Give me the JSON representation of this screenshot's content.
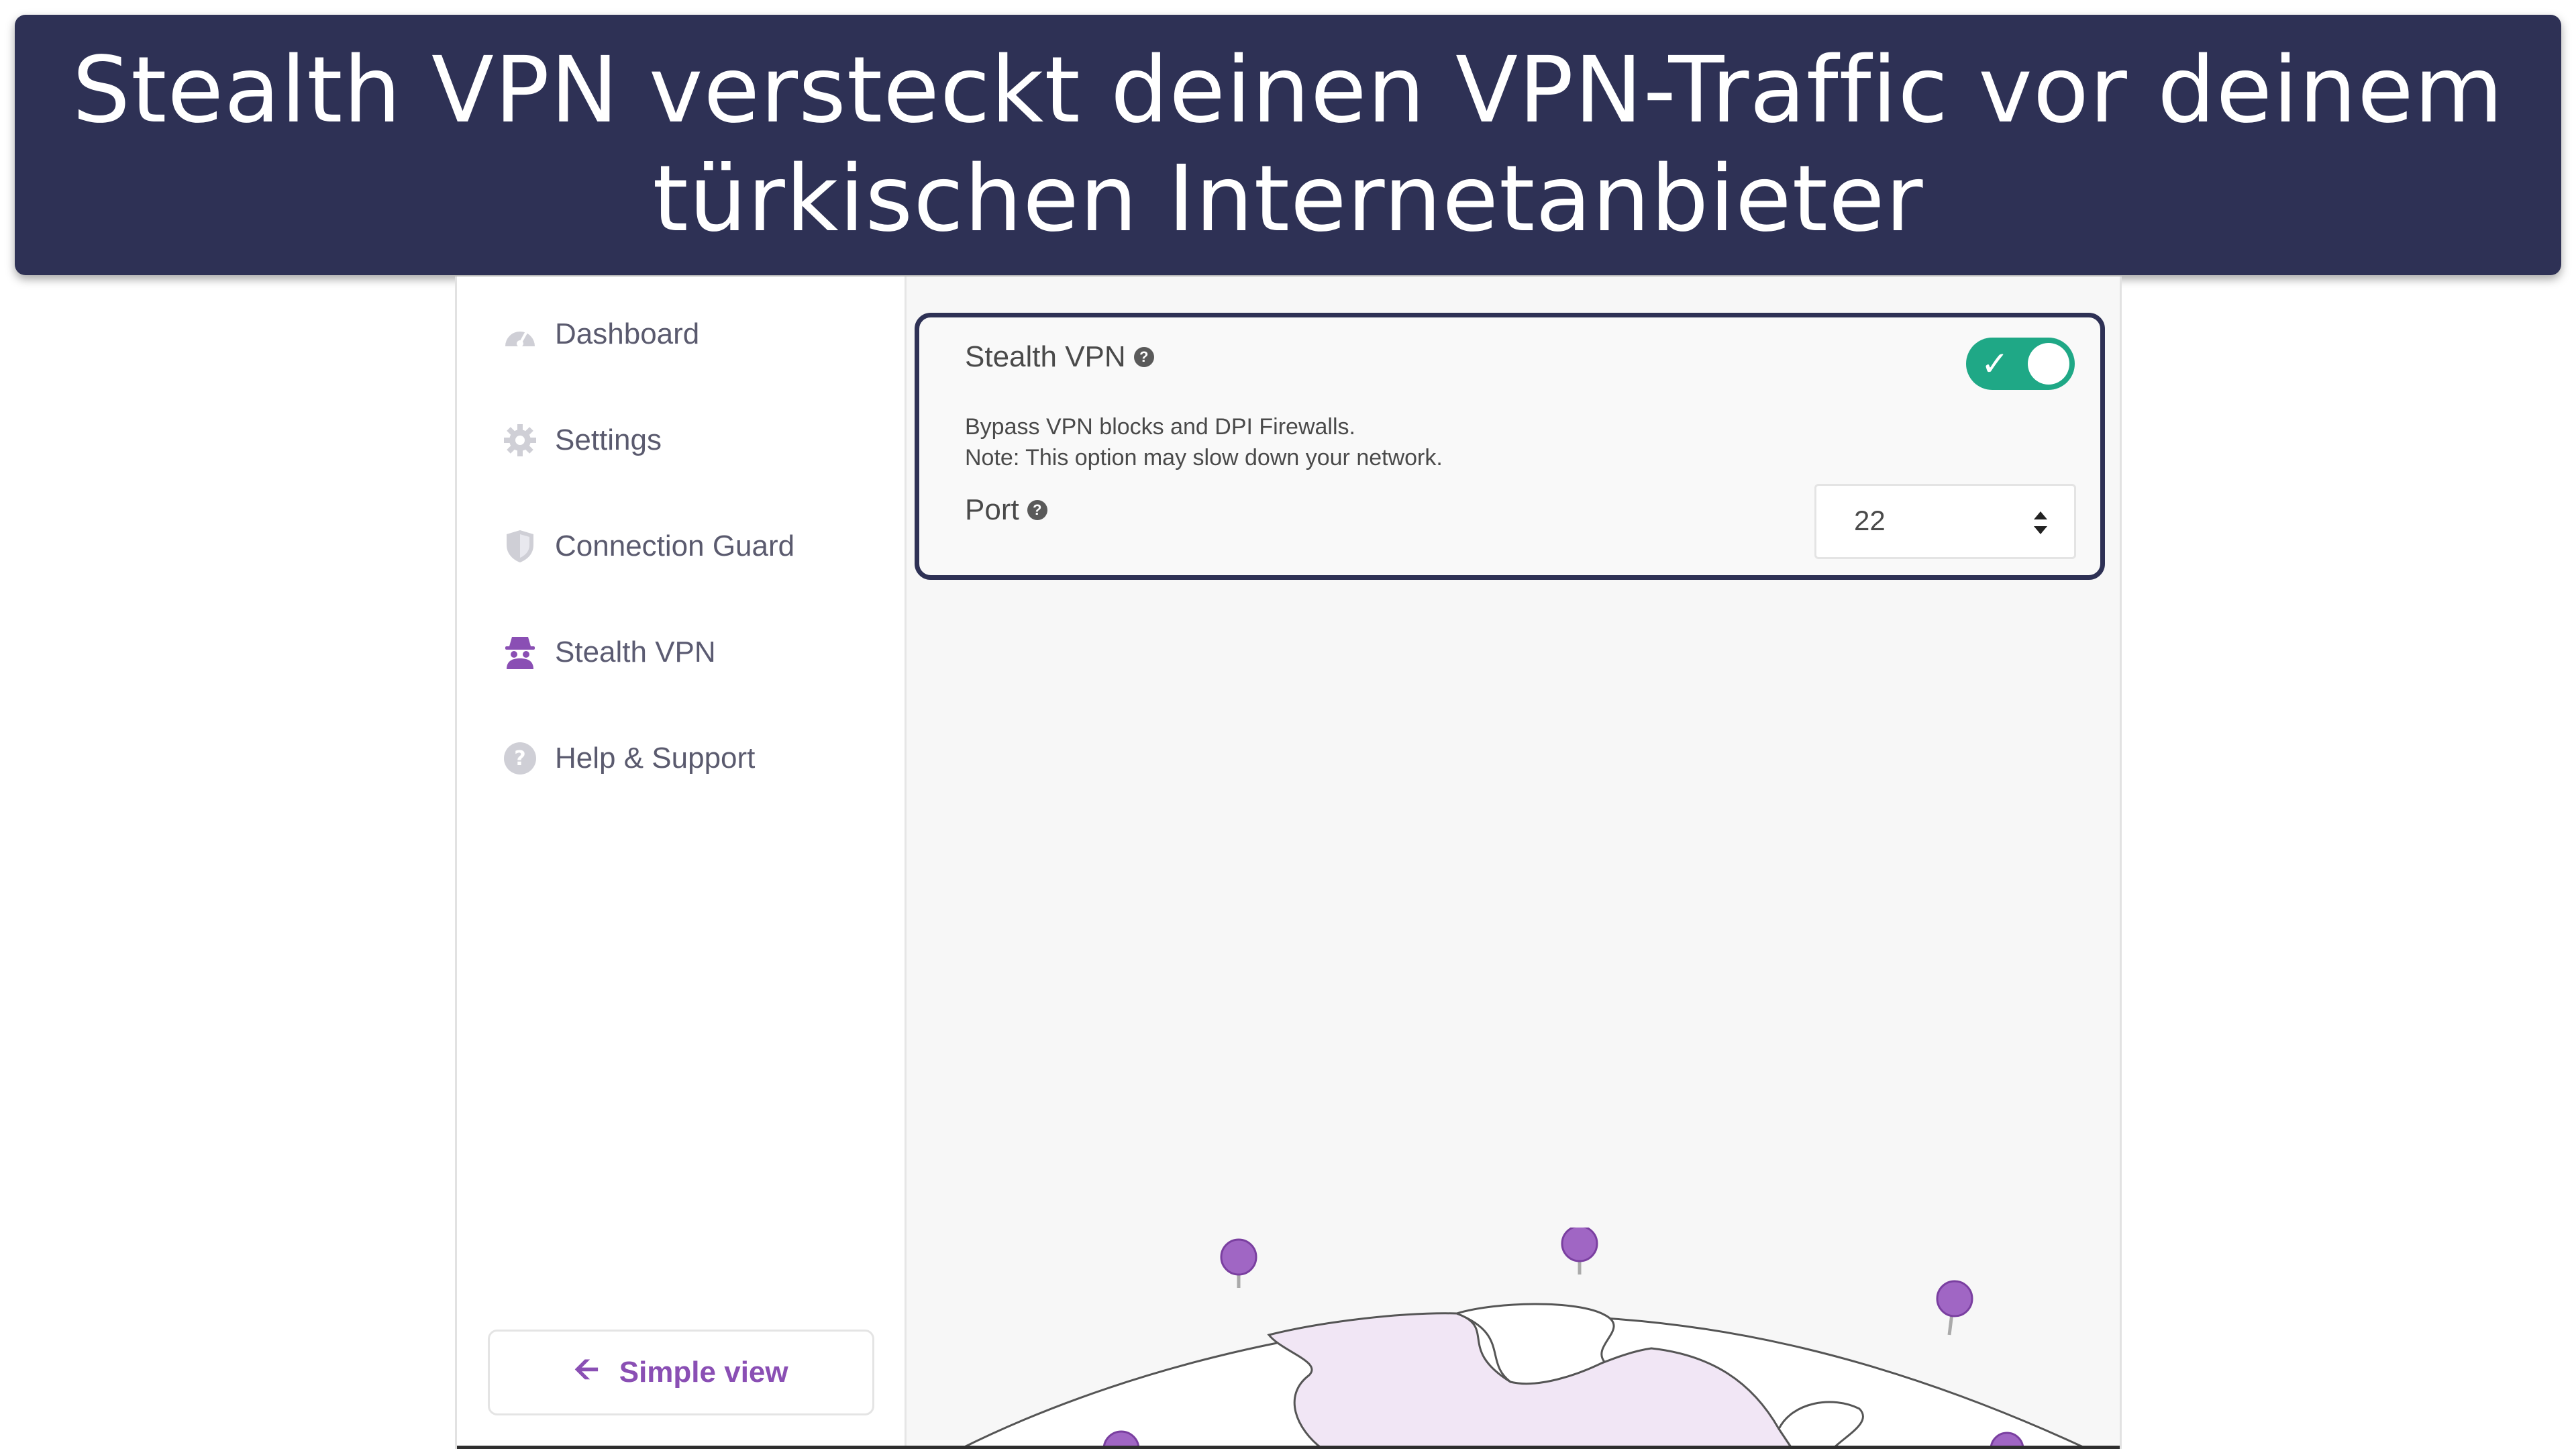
{
  "banner": {
    "caption": "Stealth VPN versteckt deinen VPN-Traffic vor deinem türkischen Internetanbieter"
  },
  "sidebar": {
    "items": [
      {
        "label": "Dashboard",
        "icon": "dashboard-icon"
      },
      {
        "label": "Settings",
        "icon": "gear-icon"
      },
      {
        "label": "Connection Guard",
        "icon": "shield-icon"
      },
      {
        "label": "Stealth VPN",
        "icon": "incognito-icon"
      },
      {
        "label": "Help & Support",
        "icon": "help-icon"
      }
    ],
    "simple_view_label": "Simple view"
  },
  "stealth_panel": {
    "title": "Stealth VPN",
    "toggle_on": true,
    "description_line1": "Bypass VPN blocks and DPI Firewalls.",
    "description_line2": "Note: This option may slow down your network.",
    "port_label": "Port",
    "port_value": "22"
  },
  "colors": {
    "banner_bg": "#2e3155",
    "accent_purple": "#8a4fb4",
    "toggle_green": "#1fa886"
  }
}
